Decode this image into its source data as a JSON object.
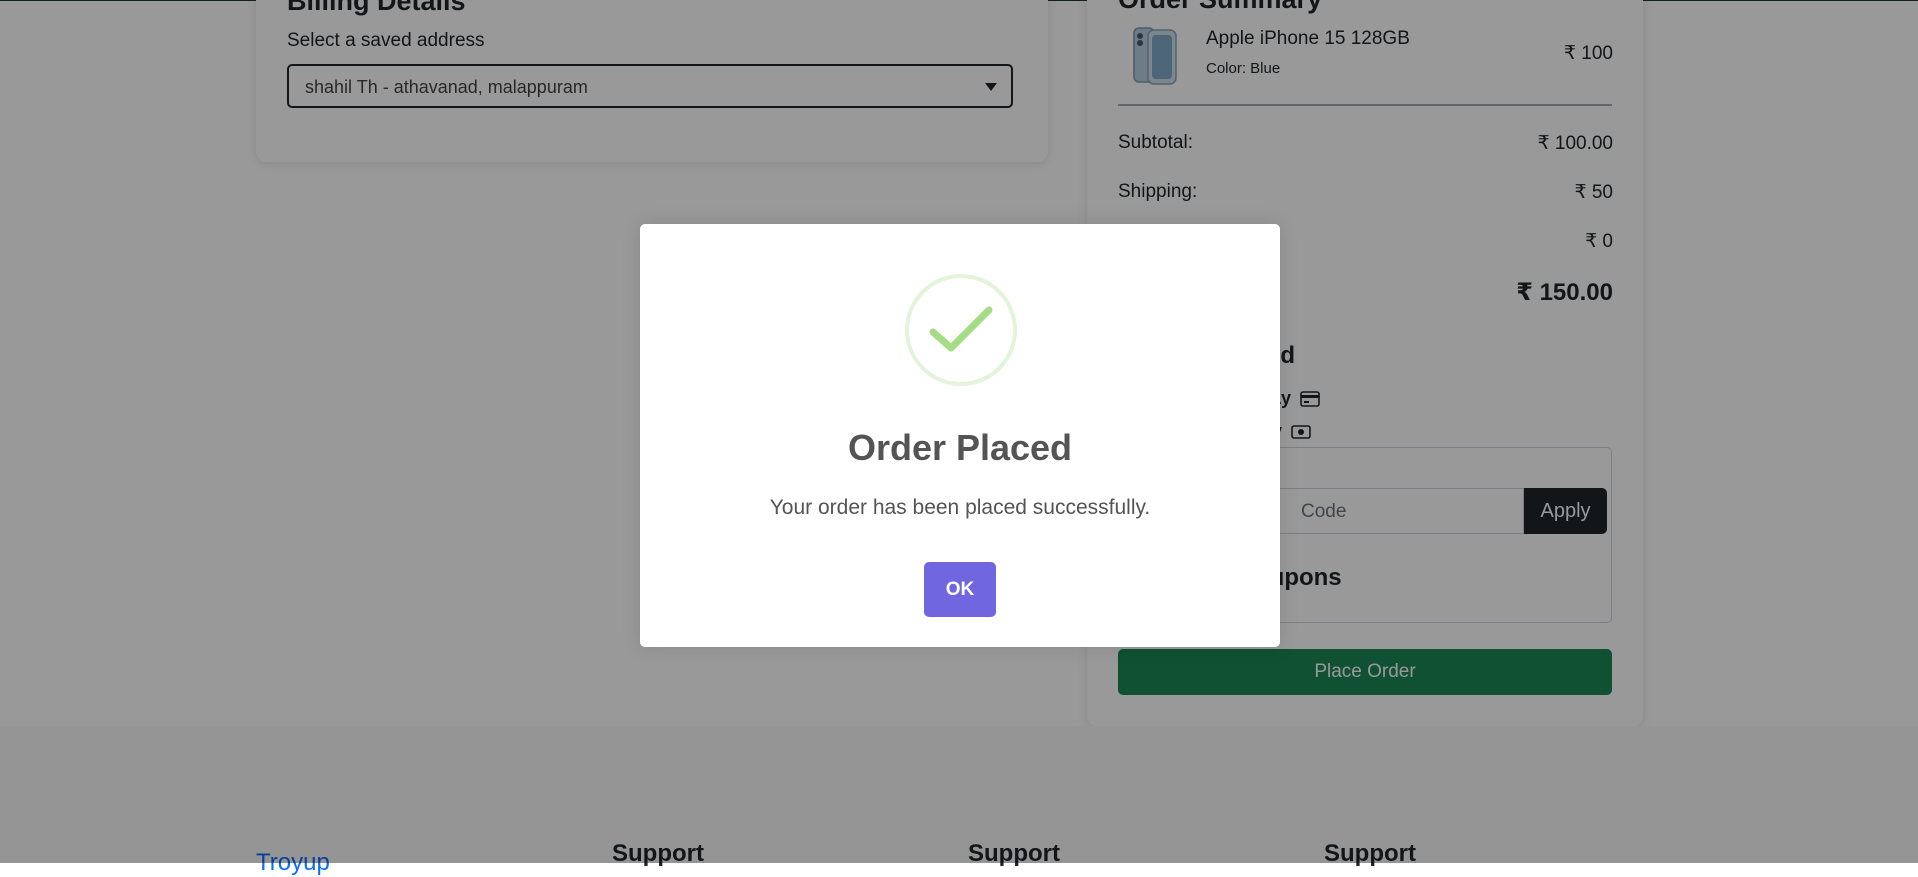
{
  "billing": {
    "title": "Billing Details",
    "subtitle": "Select a saved address",
    "selected_address": "shahil Th - athavanad, malappuram"
  },
  "summary": {
    "title": "Order Summary",
    "product": {
      "name": "Apple iPhone 15 128GB",
      "color": "Color: Blue",
      "price": "₹ 100"
    },
    "subtotal_label": "Subtotal:",
    "subtotal_value": "₹ 100.00",
    "shipping_label": "Shipping:",
    "shipping_value": "₹ 50",
    "discount_value": "₹ 0",
    "total_value": "₹ 150.00",
    "payment_heading_partial": "hod",
    "payment_option_1_partial": "rpay",
    "payment_option_2_partial": "ery",
    "coupon_placeholder_partial": "Code",
    "apply_label": "Apply",
    "coupons_partial": "oupons",
    "place_order_label": "Place Order"
  },
  "footer": {
    "brand": "Troyup",
    "col1": "Support",
    "col2": "Support",
    "col3": "Support"
  },
  "modal": {
    "title": "Order Placed",
    "message": "Your order has been placed successfully.",
    "ok_label": "OK",
    "icon": "success-check-icon"
  },
  "colors": {
    "place_order_green": "#198754",
    "modal_button": "#7066e0",
    "apply_dark": "#212529",
    "success_green": "#a5dc86"
  }
}
